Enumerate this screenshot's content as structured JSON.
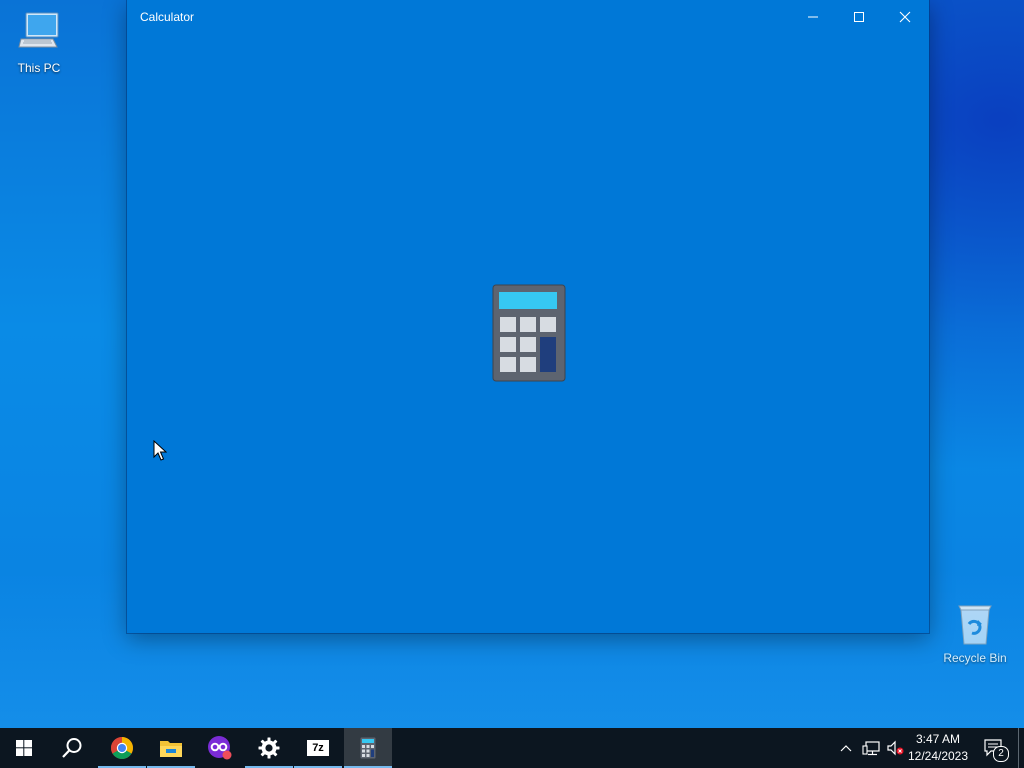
{
  "desktop": {
    "icons": [
      {
        "label": "This PC",
        "icon": "this-pc-icon"
      },
      {
        "label": "Recycle Bin",
        "icon": "recycle-bin-icon"
      }
    ]
  },
  "window": {
    "title": "Calculator",
    "controls": [
      "minimize-icon",
      "maximize-icon",
      "close-icon"
    ],
    "splash_icon": "calculator-icon",
    "background": "#0078d7"
  },
  "taskbar": {
    "apps": [
      {
        "name": "start",
        "icon": "windows-logo-icon"
      },
      {
        "name": "search",
        "icon": "search-icon"
      },
      {
        "name": "chrome",
        "icon": "chrome-icon",
        "running": true
      },
      {
        "name": "file-explorer",
        "icon": "folder-icon",
        "running": true
      },
      {
        "name": "app",
        "icon": "app-icon"
      },
      {
        "name": "settings",
        "icon": "gear-icon",
        "running": true
      },
      {
        "name": "7zip",
        "icon": "7zip-icon",
        "label": "7z",
        "running": true
      },
      {
        "name": "calculator",
        "icon": "calculator-icon",
        "running": true,
        "active": true
      }
    ],
    "tray": {
      "icons": [
        "chevron-up-icon",
        "network-icon",
        "volume-muted-icon"
      ],
      "time": "3:47 AM",
      "date": "12/24/2023",
      "notification_count": "2"
    }
  }
}
